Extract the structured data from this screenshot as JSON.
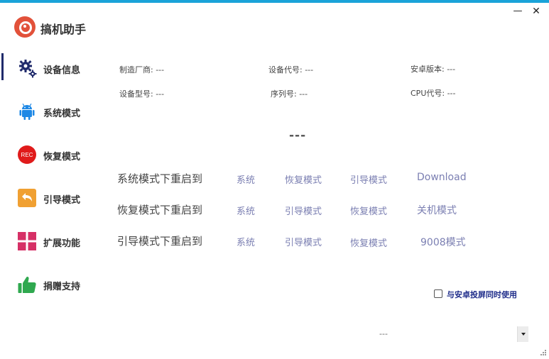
{
  "app": {
    "title": "搞机助手"
  },
  "window": {
    "minimize": "—",
    "close": "✕"
  },
  "sidebar": {
    "items": [
      {
        "label": "设备信息",
        "icon": "gears-icon",
        "active": true
      },
      {
        "label": "系统模式",
        "icon": "android-icon"
      },
      {
        "label": "恢复模式",
        "icon": "rec-icon",
        "icon_text": "REC"
      },
      {
        "label": "引导模式",
        "icon": "back-arrow-icon"
      },
      {
        "label": "扩展功能",
        "icon": "grid-icon"
      },
      {
        "label": "捐赠支持",
        "icon": "thumbs-up-icon"
      }
    ]
  },
  "device_info": {
    "manufacturer": "制造厂商: ---",
    "device_code": "设备代号: ---",
    "android_version": "安卓版本: ---",
    "model": "设备型号: ---",
    "serial": "序列号: ---",
    "cpu": "CPU代号: ---",
    "status": "---"
  },
  "reboot": {
    "system_row": {
      "label": "系统模式下重启到",
      "options": [
        "系统",
        "恢复模式",
        "引导模式",
        "Download"
      ]
    },
    "recovery_row": {
      "label": "恢复模式下重启到",
      "options": [
        "系统",
        "引导模式",
        "恢复模式",
        "关机模式"
      ]
    },
    "bootloader_row": {
      "label": "引导模式下重启到",
      "options": [
        "系统",
        "引导模式",
        "恢复模式",
        "9008模式"
      ]
    }
  },
  "mirror_checkbox": {
    "label": "与安卓投屏同时使用",
    "checked": false
  },
  "device_select": {
    "value": "---"
  },
  "colors": {
    "accent": "#1aa3d9",
    "nav_active": "#1f2a6b",
    "option_link": "#7b7fb2",
    "checkbox_label": "#1f2d8a"
  }
}
